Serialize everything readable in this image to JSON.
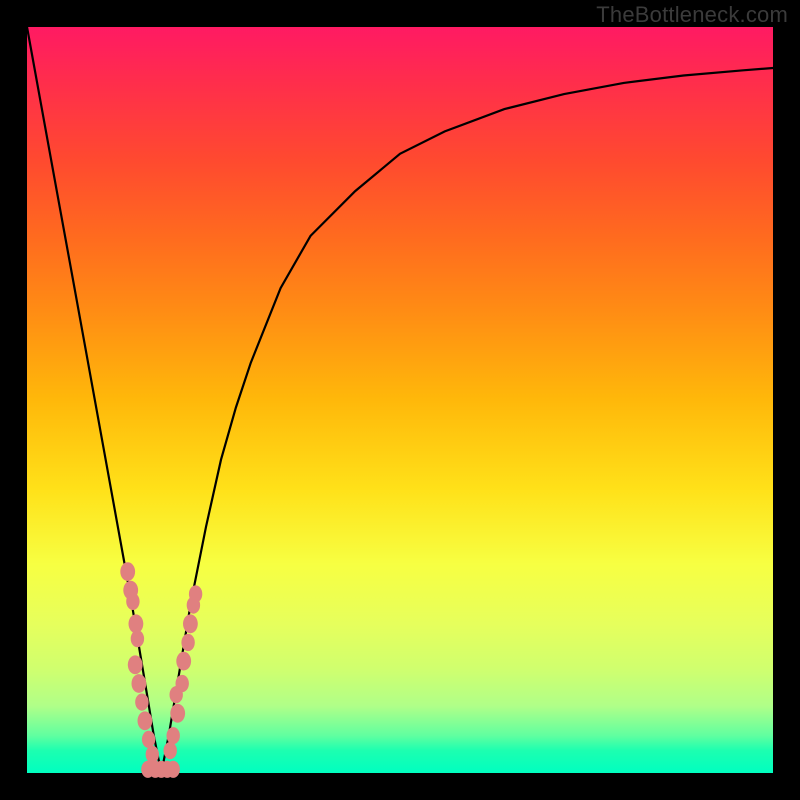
{
  "watermark": "TheBottleneck.com",
  "colors": {
    "frame": "#000000",
    "curve": "#000000",
    "marker": "#e08080"
  },
  "chart_data": {
    "type": "line",
    "title": "",
    "xlabel": "",
    "ylabel": "",
    "xlim": [
      0,
      100
    ],
    "ylim": [
      0,
      100
    ],
    "grid": false,
    "note": "V-shaped bottleneck curve. x is a normalized hardware-balance axis (0–100). y is mismatch/bottleneck percentage (0–100, 0 at bottom). Minimum (zero bottleneck) at x≈18. No axis ticks or labels are rendered in the image; values are read off by position.",
    "series": [
      {
        "name": "bottleneck-curve",
        "x": [
          0,
          2,
          4,
          6,
          8,
          10,
          12,
          14,
          16,
          17,
          18,
          19,
          20,
          22,
          24,
          26,
          28,
          30,
          34,
          38,
          44,
          50,
          56,
          64,
          72,
          80,
          88,
          96,
          100
        ],
        "y": [
          100,
          89,
          78,
          67,
          56,
          45,
          34,
          23,
          11,
          5,
          0,
          5,
          11,
          23,
          33,
          42,
          49,
          55,
          65,
          72,
          78,
          83,
          86,
          89,
          91,
          92.5,
          93.5,
          94.2,
          94.5
        ]
      }
    ],
    "markers": {
      "name": "sample-points",
      "note": "Salmon-colored jittered dots clustered around the curve's trough region.",
      "points": [
        {
          "x": 13.5,
          "y": 27.0,
          "r": 1.1
        },
        {
          "x": 13.9,
          "y": 24.5,
          "r": 1.1
        },
        {
          "x": 14.2,
          "y": 23.0,
          "r": 1.0
        },
        {
          "x": 14.6,
          "y": 20.0,
          "r": 1.1
        },
        {
          "x": 14.8,
          "y": 18.0,
          "r": 1.0
        },
        {
          "x": 14.5,
          "y": 14.5,
          "r": 1.1
        },
        {
          "x": 15.0,
          "y": 12.0,
          "r": 1.1
        },
        {
          "x": 15.4,
          "y": 9.5,
          "r": 1.0
        },
        {
          "x": 15.8,
          "y": 7.0,
          "r": 1.1
        },
        {
          "x": 16.3,
          "y": 4.5,
          "r": 1.0
        },
        {
          "x": 16.8,
          "y": 2.5,
          "r": 1.0
        },
        {
          "x": 16.2,
          "y": 0.5,
          "r": 1.0
        },
        {
          "x": 17.2,
          "y": 0.5,
          "r": 1.0
        },
        {
          "x": 18.0,
          "y": 0.5,
          "r": 1.0
        },
        {
          "x": 18.8,
          "y": 0.5,
          "r": 1.0
        },
        {
          "x": 19.6,
          "y": 0.5,
          "r": 1.0
        },
        {
          "x": 19.2,
          "y": 3.0,
          "r": 1.0
        },
        {
          "x": 19.6,
          "y": 5.0,
          "r": 1.0
        },
        {
          "x": 20.2,
          "y": 8.0,
          "r": 1.1
        },
        {
          "x": 20.0,
          "y": 10.5,
          "r": 1.0
        },
        {
          "x": 20.8,
          "y": 12.0,
          "r": 1.0
        },
        {
          "x": 21.0,
          "y": 15.0,
          "r": 1.1
        },
        {
          "x": 21.6,
          "y": 17.5,
          "r": 1.0
        },
        {
          "x": 21.9,
          "y": 20.0,
          "r": 1.1
        },
        {
          "x": 22.3,
          "y": 22.5,
          "r": 1.0
        },
        {
          "x": 22.6,
          "y": 24.0,
          "r": 1.0
        }
      ]
    }
  }
}
